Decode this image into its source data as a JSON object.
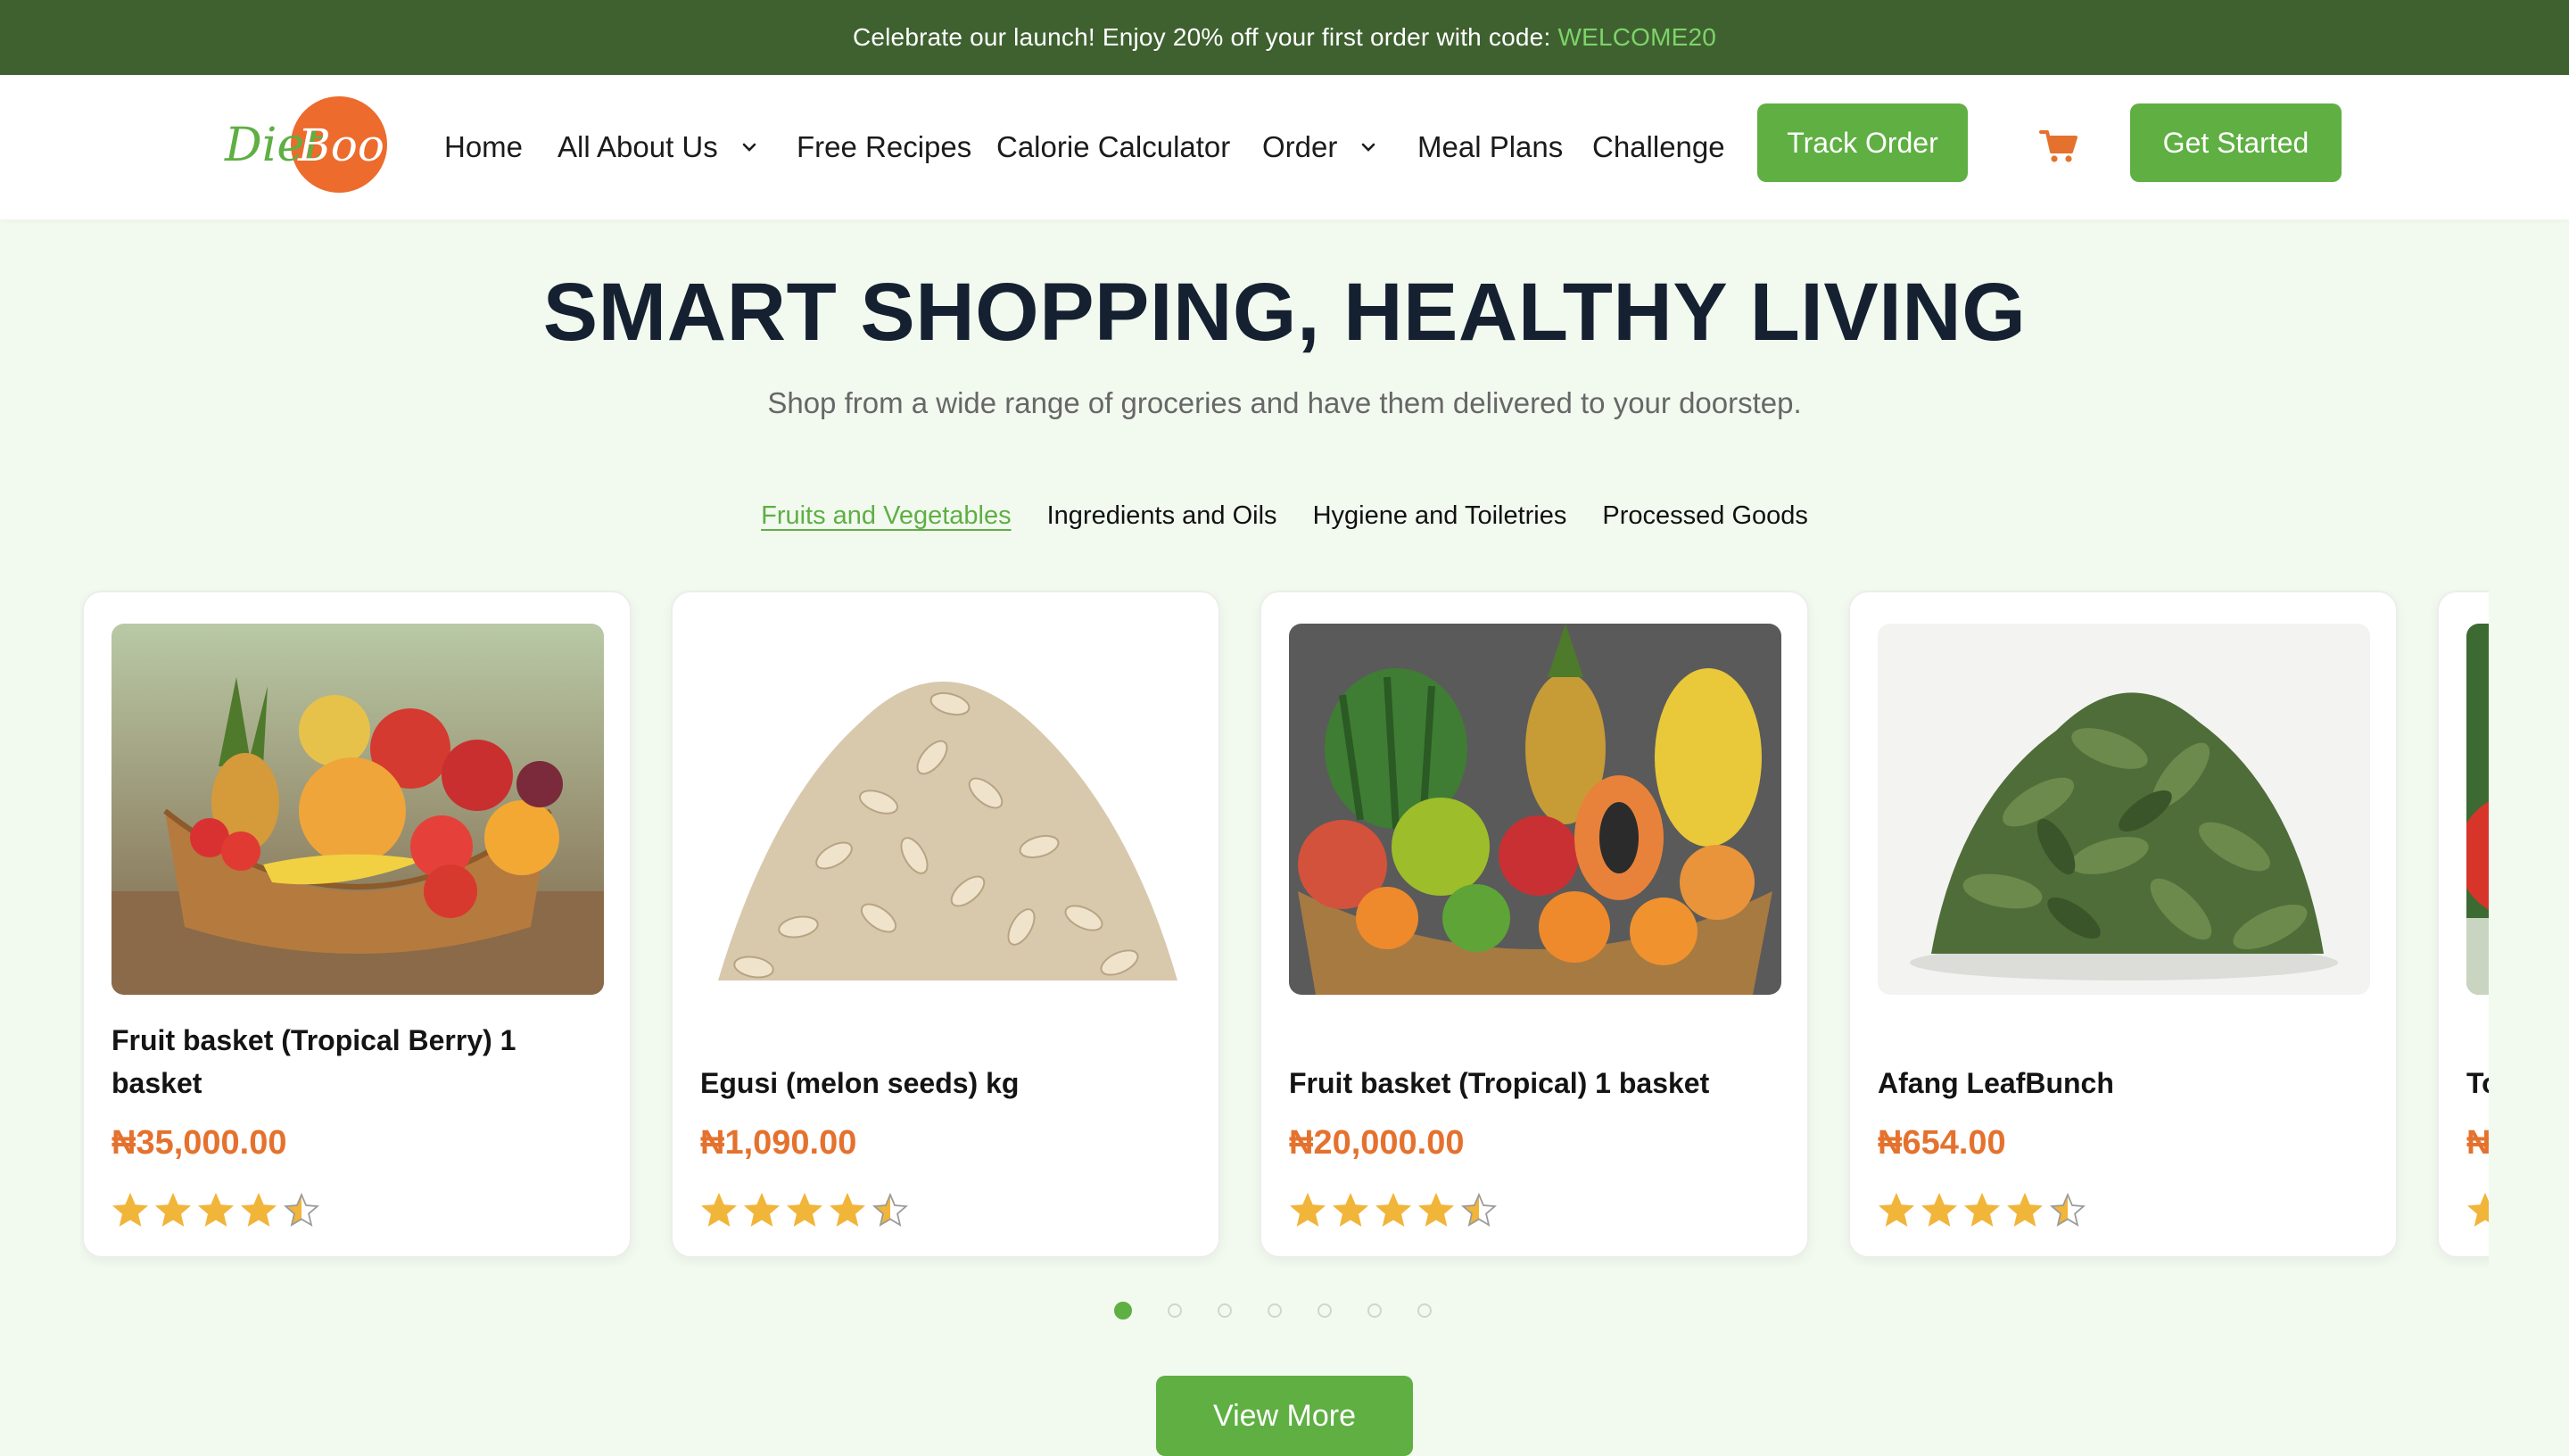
{
  "promo": {
    "text": "Celebrate our launch! Enjoy 20% off your first order with code:",
    "code": "WELCOME20"
  },
  "brand": {
    "logo_word_1": "Diet",
    "logo_word_2": "Boon",
    "green": "#5faf43",
    "orange": "#e4722e",
    "dark_green": "#3f6130"
  },
  "nav": {
    "home": "Home",
    "about": "All About Us",
    "recipes": "Free Recipes",
    "calculator": "Calorie Calculator",
    "order": "Order",
    "meal_plans": "Meal Plans",
    "challenge": "Challenge",
    "track_order": "Track Order",
    "cart_icon": "shopping-cart-icon",
    "get_started": "Get Started"
  },
  "hero": {
    "title": "SMART SHOPPING, HEALTHY LIVING",
    "subtitle": "Shop from a wide range of groceries and have them delivered to your doorstep."
  },
  "tabs": [
    {
      "label": "Fruits and Vegetables",
      "active": true
    },
    {
      "label": "Ingredients and Oils",
      "active": false
    },
    {
      "label": "Hygiene and Toiletries",
      "active": false
    },
    {
      "label": "Processed Goods",
      "active": false
    }
  ],
  "products": [
    {
      "name": "Fruit basket (Tropical Berry) 1 basket",
      "price": "₦35,000.00",
      "rating": 4.5,
      "image": "fruit-basket-berry"
    },
    {
      "name": "Egusi (melon seeds) kg",
      "price": "₦1,090.00",
      "rating": 4.5,
      "image": "melon-seeds"
    },
    {
      "name": "Fruit basket (Tropical) 1 basket",
      "price": "₦20,000.00",
      "rating": 4.5,
      "image": "fruit-basket-tropical"
    },
    {
      "name": "Afang LeafBunch",
      "price": "₦654.00",
      "rating": 4.5,
      "image": "afang-leaves"
    },
    {
      "name": "To",
      "price": "₦",
      "rating": 4.5,
      "image": "tomatoes-partial"
    }
  ],
  "carousel": {
    "page_count": 7,
    "active_page": 1
  },
  "view_more": "View More"
}
